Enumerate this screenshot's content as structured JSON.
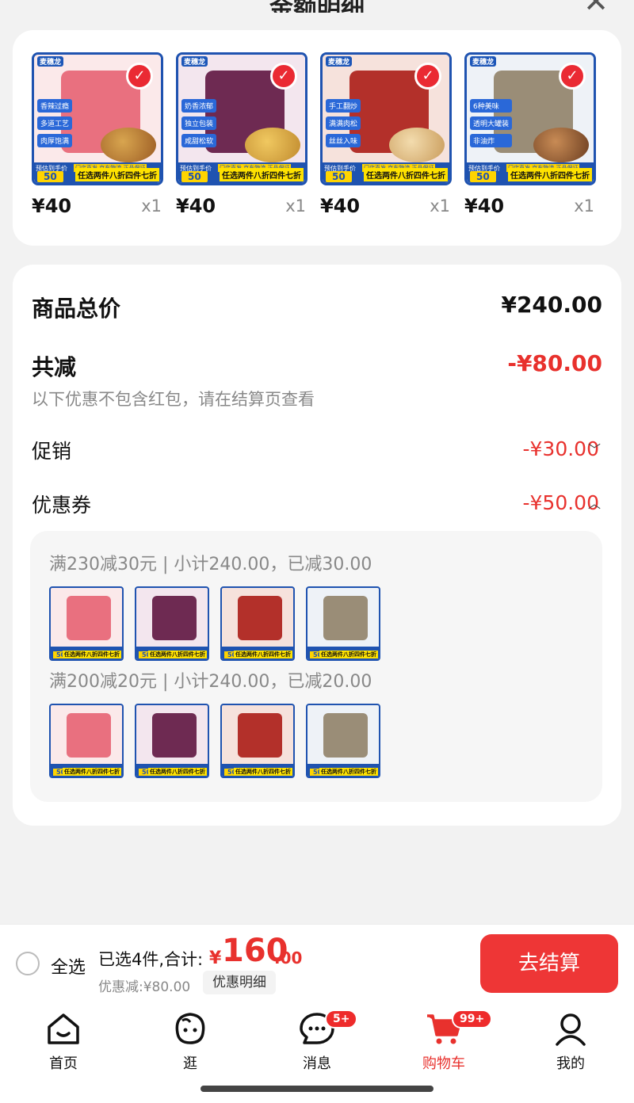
{
  "header": {
    "title": "金额明细"
  },
  "products": [
    {
      "price": "¥40",
      "qty": "x1",
      "estimate_label": "预估到手价",
      "estimate_value": "50",
      "promo": "任选两件八折四件七折",
      "color": "#e9707f",
      "tags": [
        "香辣过瘾",
        "多道工艺",
        "肉厚饱满"
      ],
      "brand": "麦穗龙"
    },
    {
      "price": "¥40",
      "qty": "x1",
      "estimate_label": "预估到手价",
      "estimate_value": "50",
      "promo": "任选两件八折四件七折",
      "color": "#6e2a52",
      "tags": [
        "奶香浓郁",
        "独立包装",
        "咸甜松软"
      ],
      "brand": "麦穗龙"
    },
    {
      "price": "¥40",
      "qty": "x1",
      "estimate_label": "预估到手价",
      "estimate_value": "50",
      "promo": "任选两件八折四件七折",
      "color": "#b3302a",
      "tags": [
        "手工翻炒",
        "满满肉松",
        "丝丝入味"
      ],
      "brand": "麦穗龙"
    },
    {
      "price": "¥40",
      "qty": "x1",
      "estimate_label": "预估到手价",
      "estimate_value": "50",
      "promo": "任选两件八折四件七折",
      "color": "#9a8d77",
      "tags": [
        "6种美味",
        "透明大罐装",
        "非油炸"
      ],
      "brand": "麦穗龙"
    }
  ],
  "shipping_badge": "门店直发 京东物流 正品保证",
  "summary": {
    "goods_total_label": "商品总价",
    "goods_total_value": "¥240.00",
    "reduction_label": "共减",
    "reduction_value": "-¥80.00",
    "note": "以下优惠不包含红包，请在结算页查看",
    "promotion_label": "促销",
    "promotion_value": "-¥30.00",
    "coupon_label": "优惠券",
    "coupon_value": "-¥50.00",
    "coupon_lines": [
      "满230减30元 | 小计240.00，已减30.00",
      "满200减20元 | 小计240.00，已减20.00"
    ]
  },
  "checkout": {
    "select_all": "全选",
    "selected_text": "已选4件,合计:",
    "currency": "¥",
    "total_int": "160",
    "total_dec": ".00",
    "discount_text": "优惠减:¥80.00",
    "detail_button": "优惠明细",
    "checkout_button": "去结算"
  },
  "nav": {
    "items": [
      {
        "label": "首页",
        "icon": "home-icon"
      },
      {
        "label": "逛",
        "icon": "browse-icon"
      },
      {
        "label": "消息",
        "icon": "message-icon",
        "badge": "5+"
      },
      {
        "label": "购物车",
        "icon": "cart-icon",
        "badge": "99+",
        "active": true
      },
      {
        "label": "我的",
        "icon": "profile-icon"
      }
    ]
  },
  "colors": {
    "accent": "#e8312d",
    "brand_blue": "#1f53b0",
    "promo_yellow": "#ffe200"
  }
}
